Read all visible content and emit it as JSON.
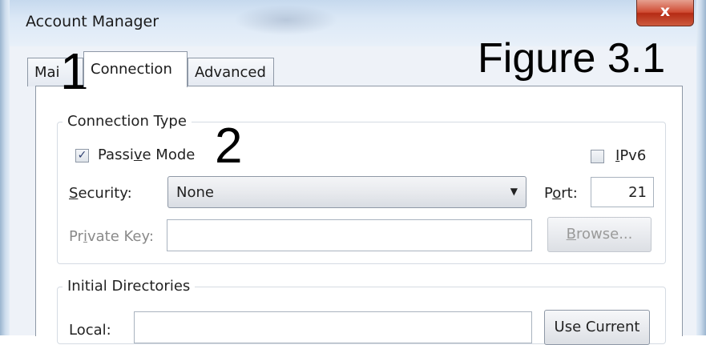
{
  "window": {
    "title": "Account Manager",
    "close_glyph": "x"
  },
  "tabs": [
    {
      "label": "Mai",
      "active": false
    },
    {
      "label": "Connection",
      "active": true
    },
    {
      "label": "Advanced",
      "active": false
    }
  ],
  "annotations": {
    "marker_1": "1",
    "marker_2": "2",
    "figure": "Figure 3.1"
  },
  "connection_type": {
    "group_label": "Connection Type",
    "passive_mode": {
      "label_pre": "Passi",
      "label_accel": "v",
      "label_post": "e Mode",
      "checked": true
    },
    "ipv6": {
      "label_accel": "I",
      "label_post": "Pv6",
      "checked": false
    },
    "security": {
      "label_accel": "S",
      "label_post": "ecurity:",
      "value": "None"
    },
    "port": {
      "label_pre": "P",
      "label_accel": "o",
      "label_post": "rt:",
      "value": "21"
    },
    "private_key": {
      "label_pre": "Pr",
      "label_accel": "i",
      "label_post": "vate Key:",
      "value": ""
    },
    "browse_button": {
      "label_accel": "B",
      "label_post": "rowse..."
    }
  },
  "initial_directories": {
    "group_label": "Initial Directories",
    "local": {
      "label": "Local:",
      "value": ""
    },
    "use_current_button": "Use Current"
  },
  "icons": {
    "check": "✓",
    "dropdown": "▼"
  }
}
